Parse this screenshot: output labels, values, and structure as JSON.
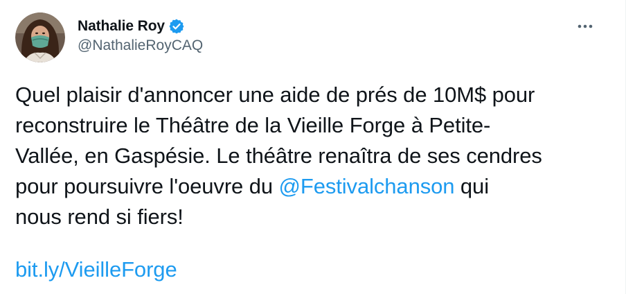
{
  "author": {
    "display_name": "Nathalie Roy",
    "handle": "@NathalieRoyCAQ",
    "verified": true,
    "avatar_icon": "avatar-photo"
  },
  "menu": {
    "icon": "more-horizontal-icon"
  },
  "tweet": {
    "line1": "Quel plaisir d'annoncer une aide de prés de 10M$ pour",
    "line2": "reconstruire le Théâtre de la Vieille Forge à Petite-",
    "line3": "Vallée, en Gaspésie. Le théâtre renaîtra de ses cendres",
    "line4_before": "pour poursuivre l'oeuvre du ",
    "mention": "@Festivalchanson",
    "line4_after": " qui",
    "line5": "nous rend si fiers!",
    "link": "bit.ly/VieilleForge"
  },
  "colors": {
    "accent": "#1d9bf0",
    "text": "#0f1419",
    "secondary": "#536471"
  }
}
